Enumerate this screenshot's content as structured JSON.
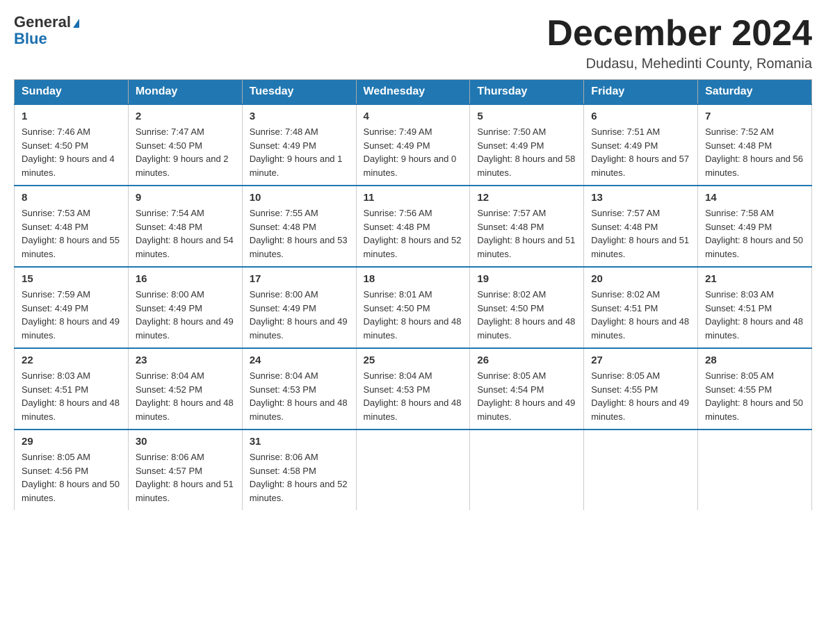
{
  "logo": {
    "line1": "General",
    "triangle": "▶",
    "line2": "Blue"
  },
  "title": "December 2024",
  "location": "Dudasu, Mehedinti County, Romania",
  "days_header": [
    "Sunday",
    "Monday",
    "Tuesday",
    "Wednesday",
    "Thursday",
    "Friday",
    "Saturday"
  ],
  "weeks": [
    [
      {
        "day": "1",
        "sunrise": "7:46 AM",
        "sunset": "4:50 PM",
        "daylight": "9 hours and 4 minutes."
      },
      {
        "day": "2",
        "sunrise": "7:47 AM",
        "sunset": "4:50 PM",
        "daylight": "9 hours and 2 minutes."
      },
      {
        "day": "3",
        "sunrise": "7:48 AM",
        "sunset": "4:49 PM",
        "daylight": "9 hours and 1 minute."
      },
      {
        "day": "4",
        "sunrise": "7:49 AM",
        "sunset": "4:49 PM",
        "daylight": "9 hours and 0 minutes."
      },
      {
        "day": "5",
        "sunrise": "7:50 AM",
        "sunset": "4:49 PM",
        "daylight": "8 hours and 58 minutes."
      },
      {
        "day": "6",
        "sunrise": "7:51 AM",
        "sunset": "4:49 PM",
        "daylight": "8 hours and 57 minutes."
      },
      {
        "day": "7",
        "sunrise": "7:52 AM",
        "sunset": "4:48 PM",
        "daylight": "8 hours and 56 minutes."
      }
    ],
    [
      {
        "day": "8",
        "sunrise": "7:53 AM",
        "sunset": "4:48 PM",
        "daylight": "8 hours and 55 minutes."
      },
      {
        "day": "9",
        "sunrise": "7:54 AM",
        "sunset": "4:48 PM",
        "daylight": "8 hours and 54 minutes."
      },
      {
        "day": "10",
        "sunrise": "7:55 AM",
        "sunset": "4:48 PM",
        "daylight": "8 hours and 53 minutes."
      },
      {
        "day": "11",
        "sunrise": "7:56 AM",
        "sunset": "4:48 PM",
        "daylight": "8 hours and 52 minutes."
      },
      {
        "day": "12",
        "sunrise": "7:57 AM",
        "sunset": "4:48 PM",
        "daylight": "8 hours and 51 minutes."
      },
      {
        "day": "13",
        "sunrise": "7:57 AM",
        "sunset": "4:48 PM",
        "daylight": "8 hours and 51 minutes."
      },
      {
        "day": "14",
        "sunrise": "7:58 AM",
        "sunset": "4:49 PM",
        "daylight": "8 hours and 50 minutes."
      }
    ],
    [
      {
        "day": "15",
        "sunrise": "7:59 AM",
        "sunset": "4:49 PM",
        "daylight": "8 hours and 49 minutes."
      },
      {
        "day": "16",
        "sunrise": "8:00 AM",
        "sunset": "4:49 PM",
        "daylight": "8 hours and 49 minutes."
      },
      {
        "day": "17",
        "sunrise": "8:00 AM",
        "sunset": "4:49 PM",
        "daylight": "8 hours and 49 minutes."
      },
      {
        "day": "18",
        "sunrise": "8:01 AM",
        "sunset": "4:50 PM",
        "daylight": "8 hours and 48 minutes."
      },
      {
        "day": "19",
        "sunrise": "8:02 AM",
        "sunset": "4:50 PM",
        "daylight": "8 hours and 48 minutes."
      },
      {
        "day": "20",
        "sunrise": "8:02 AM",
        "sunset": "4:51 PM",
        "daylight": "8 hours and 48 minutes."
      },
      {
        "day": "21",
        "sunrise": "8:03 AM",
        "sunset": "4:51 PM",
        "daylight": "8 hours and 48 minutes."
      }
    ],
    [
      {
        "day": "22",
        "sunrise": "8:03 AM",
        "sunset": "4:51 PM",
        "daylight": "8 hours and 48 minutes."
      },
      {
        "day": "23",
        "sunrise": "8:04 AM",
        "sunset": "4:52 PM",
        "daylight": "8 hours and 48 minutes."
      },
      {
        "day": "24",
        "sunrise": "8:04 AM",
        "sunset": "4:53 PM",
        "daylight": "8 hours and 48 minutes."
      },
      {
        "day": "25",
        "sunrise": "8:04 AM",
        "sunset": "4:53 PM",
        "daylight": "8 hours and 48 minutes."
      },
      {
        "day": "26",
        "sunrise": "8:05 AM",
        "sunset": "4:54 PM",
        "daylight": "8 hours and 49 minutes."
      },
      {
        "day": "27",
        "sunrise": "8:05 AM",
        "sunset": "4:55 PM",
        "daylight": "8 hours and 49 minutes."
      },
      {
        "day": "28",
        "sunrise": "8:05 AM",
        "sunset": "4:55 PM",
        "daylight": "8 hours and 50 minutes."
      }
    ],
    [
      {
        "day": "29",
        "sunrise": "8:05 AM",
        "sunset": "4:56 PM",
        "daylight": "8 hours and 50 minutes."
      },
      {
        "day": "30",
        "sunrise": "8:06 AM",
        "sunset": "4:57 PM",
        "daylight": "8 hours and 51 minutes."
      },
      {
        "day": "31",
        "sunrise": "8:06 AM",
        "sunset": "4:58 PM",
        "daylight": "8 hours and 52 minutes."
      },
      null,
      null,
      null,
      null
    ]
  ]
}
